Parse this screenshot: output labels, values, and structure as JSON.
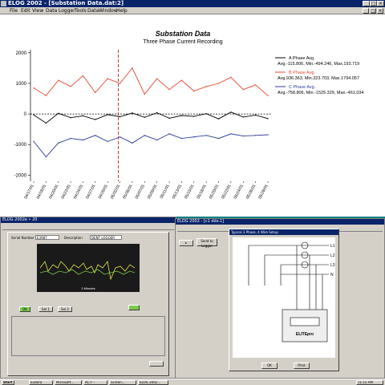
{
  "window": {
    "title": "ELOG 2002 - [Substation Data.dat:2]",
    "controls": [
      "_",
      "□",
      "×"
    ]
  },
  "menu": [
    "File",
    "Edit",
    "View",
    "Data",
    "Logger",
    "Tools",
    "Data",
    "Window",
    "Help"
  ],
  "chart_data": {
    "type": "line",
    "title": "Substation Data",
    "subtitle": "Three Phase Current Recording",
    "xlabel": "",
    "ylabel": "",
    "ylim": [
      -2200,
      2100
    ],
    "yticks": [
      2000,
      1000,
      0,
      -1000,
      -2000
    ],
    "categories": [
      "04/17/01",
      "04/18/01",
      "04/20/01",
      "04/22/01",
      "04/24/01",
      "04/27/01",
      "04/29/01",
      "05/02/01",
      "05/05/01",
      "05/07/01",
      "05/09/01",
      "05/11/01",
      "05/13/01",
      "05/15/01",
      "05/18/01",
      "05/20/01",
      "05/22/01",
      "05/24/01",
      "05/26/01",
      "05/28/01"
    ],
    "marker_category": "05/02/01",
    "grid": false,
    "legend_position": "right",
    "series": [
      {
        "name": "A Phase  Avg.",
        "stats": "Avg.-115.806, Min.-494.246, Max.193.719",
        "color": "#000000",
        "values": [
          -30,
          -300,
          20,
          -120,
          -60,
          -180,
          -20,
          -90,
          30,
          -110,
          40,
          -140,
          -50,
          -80,
          10,
          -160,
          60,
          -100,
          -40,
          -150
        ]
      },
      {
        "name": "B Phase  Avg.",
        "stats": "Avg.936.363, Min.323.703, Max.1794.057",
        "color": "#e8452f",
        "values": [
          850,
          600,
          1100,
          900,
          1250,
          700,
          1150,
          1000,
          1500,
          650,
          1150,
          800,
          1100,
          750,
          900,
          1000,
          1200,
          800,
          950,
          600
        ]
      },
      {
        "name": "C Phase  Avg.",
        "stats": "Avg.-758.806, Min.-1525.329, Max.-461.034",
        "color": "#2c3c9e",
        "values": [
          -900,
          -1400,
          -950,
          -800,
          -850,
          -700,
          -900,
          -750,
          -950,
          -700,
          -850,
          -650,
          -800,
          -750,
          -700,
          -800,
          -650,
          -720,
          -700,
          -680
        ]
      }
    ]
  },
  "logger_window": {
    "title": "ELOG 2002e • 20",
    "chart_caption": "3 Minutes",
    "serial_label": "Serial Number",
    "serial_value": "E3987",
    "description_label": "Description",
    "description_value": "DENT LOGGER",
    "buttons": [
      "OK",
      "Sel 1",
      "Sel 2"
    ]
  },
  "setup_window": {
    "title": "ELOG 2002 - [c1 dds:1]",
    "dialog_title": "Typical 3 Phase, 4 Wire Setup",
    "lines": [
      "L1",
      "L2",
      "L3",
      "N"
    ],
    "device_label": "ELITEpro",
    "buttons": [
      "OK",
      "Print",
      "Send to Logger"
    ]
  },
  "taskbar": {
    "start": "Start",
    "tasks": [
      "Eudora",
      "Microsoft...",
      "ACT! -",
      "Screen...",
      "ELOG 2002..."
    ],
    "clock": "11:15 AM"
  }
}
